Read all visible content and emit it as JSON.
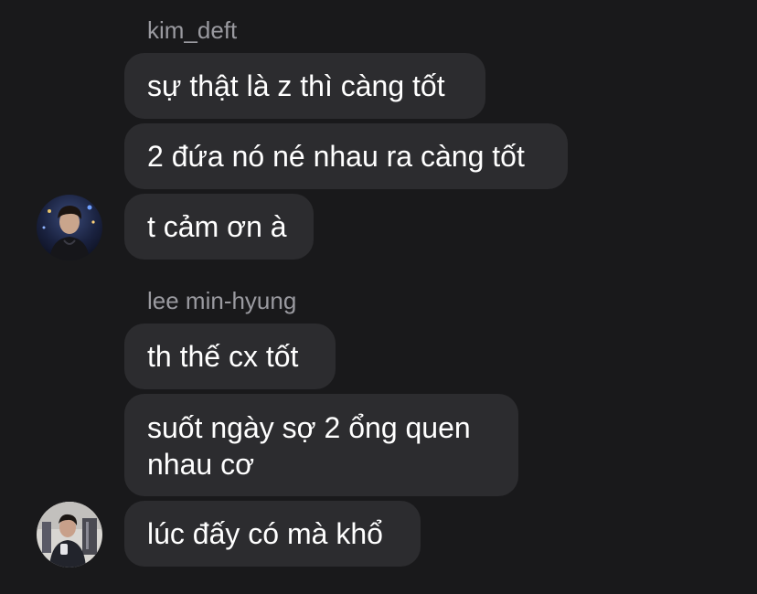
{
  "groups": [
    {
      "sender": "kim_deft",
      "messages": [
        "sự thật là z thì càng tốt",
        "2 đứa nó né nhau ra càng tốt",
        "t cảm ơn à"
      ],
      "avatar": "user-avatar-photo"
    },
    {
      "sender": "lee min-hyung",
      "messages": [
        "th thế cx tốt",
        "suốt ngày sợ 2 ổng quen nhau cơ",
        "lúc đấy có mà khổ"
      ],
      "avatar": "user-avatar-photo"
    }
  ],
  "colors": {
    "background": "#19191b",
    "bubble": "#2c2c2f",
    "sender_name": "#9a9aa0",
    "text": "#ffffff"
  }
}
